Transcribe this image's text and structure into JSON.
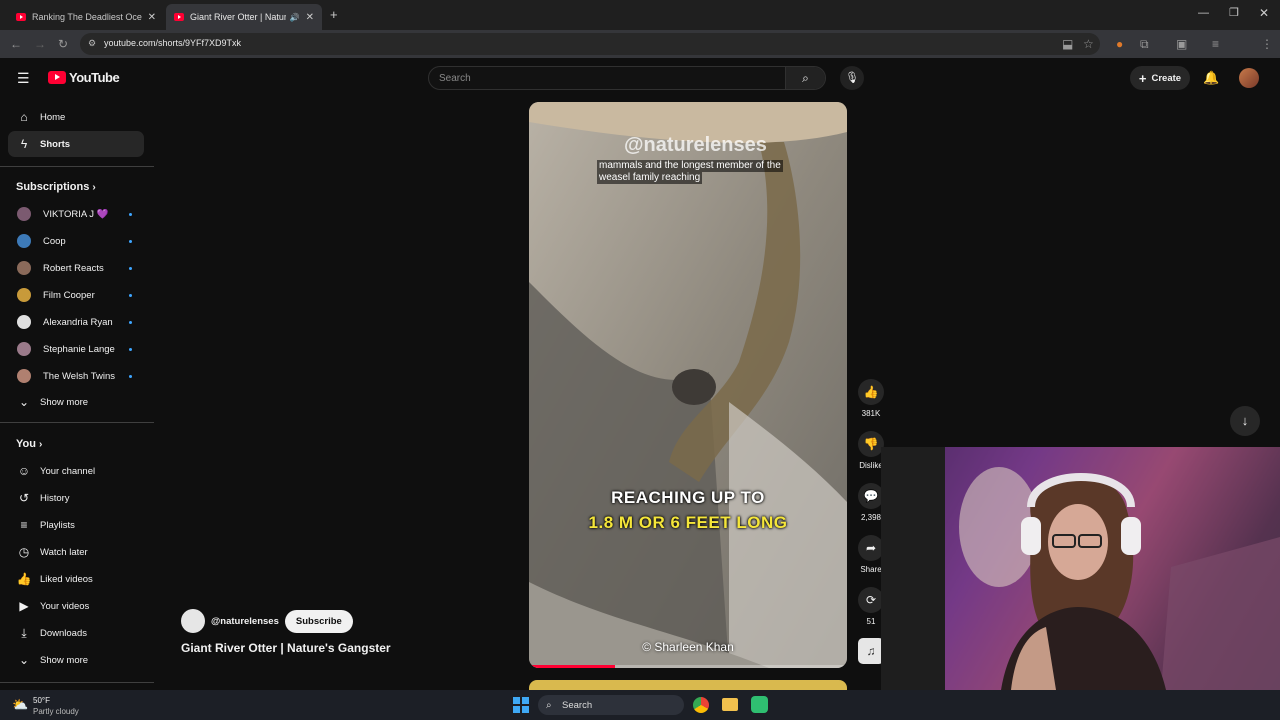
{
  "browser": {
    "tabs": [
      {
        "title": "Ranking The Deadliest Ocean P",
        "active": false
      },
      {
        "title": "Giant River Otter | Nature's",
        "active": true
      }
    ],
    "new_tab": "+",
    "url": "youtube.com/shorts/9YFf7XD9Txk"
  },
  "youtube": {
    "logo_text": "YouTube",
    "search_placeholder": "Search",
    "create_label": "Create",
    "nav": [
      {
        "label": "Home",
        "icon": "home-icon"
      },
      {
        "label": "Shorts",
        "icon": "shorts-icon"
      }
    ],
    "subscriptions_title": "Subscriptions",
    "subscriptions": [
      {
        "name": "VIKTORIA J 💜",
        "color": "#7b5a70"
      },
      {
        "name": "Coop",
        "color": "#3d7ab8"
      },
      {
        "name": "Robert Reacts",
        "color": "#8a6a5a"
      },
      {
        "name": "Film Cooper",
        "color": "#c89a3a"
      },
      {
        "name": "Alexandria Ryan",
        "color": "#e0e0e0"
      },
      {
        "name": "Stephanie Lange",
        "color": "#9a7a8a"
      },
      {
        "name": "The Welsh Twins",
        "color": "#b08070"
      }
    ],
    "show_more": "Show more",
    "you_title": "You",
    "you_items": [
      {
        "label": "Your channel",
        "icon": "channel-icon"
      },
      {
        "label": "History",
        "icon": "history-icon"
      },
      {
        "label": "Playlists",
        "icon": "playlists-icon"
      },
      {
        "label": "Watch later",
        "icon": "clock-icon"
      },
      {
        "label": "Liked videos",
        "icon": "thumb-up-icon"
      },
      {
        "label": "Your videos",
        "icon": "video-icon"
      },
      {
        "label": "Downloads",
        "icon": "download-icon"
      }
    ],
    "show_more_2": "Show more",
    "short": {
      "watermark": "@naturelenses",
      "caption_line1": "mammals and the longest member of the",
      "caption_line2": "weasel family reaching",
      "big_line1": "REACHING UP TO",
      "big_line2": "1.8 M OR 6 FEET LONG",
      "credit": "© Sharleen Khan",
      "progress": 0.27
    },
    "actions": {
      "likes": "381K",
      "dislike": "Dislike",
      "comments": "2,398",
      "share": "Share",
      "remix": "51"
    },
    "channel": {
      "handle": "@naturelenses",
      "subscribe": "Subscribe"
    },
    "video_title": "Giant River Otter | Nature's Gangster"
  },
  "taskbar": {
    "weather_temp": "50°F",
    "weather_desc": "Partly cloudy",
    "search": "Search"
  }
}
